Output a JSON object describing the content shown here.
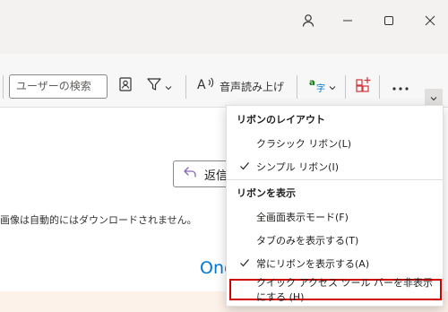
{
  "titlebar": {
    "icons": [
      "profile-icon",
      "minimize-icon",
      "maximize-icon",
      "close-icon"
    ]
  },
  "ribbon": {
    "search_placeholder": "ユーザーの検索",
    "read_aloud_label": "音声読み上げ"
  },
  "content": {
    "reply_label": "返信",
    "notice_text": "画像は自動的にはダウンロードされません。",
    "brand_text": "One"
  },
  "menu": {
    "section1_title": "リボンのレイアウト",
    "classic": "クラシック リボン(L)",
    "simplified": "シンプル リボン(I)",
    "section2_title": "リボンを表示",
    "fullscreen": "全画面表示モード(F)",
    "tabs_only": "タブのみを表示する(T)",
    "always_show": "常にリボンを表示する(A)",
    "hide_qat": "クイック アクセス ツール バーを非表示にする (H)"
  },
  "colors": {
    "accent": "#0078d4",
    "highlight_border": "#d00000",
    "titlebar_bg": "#f3f2f1"
  }
}
